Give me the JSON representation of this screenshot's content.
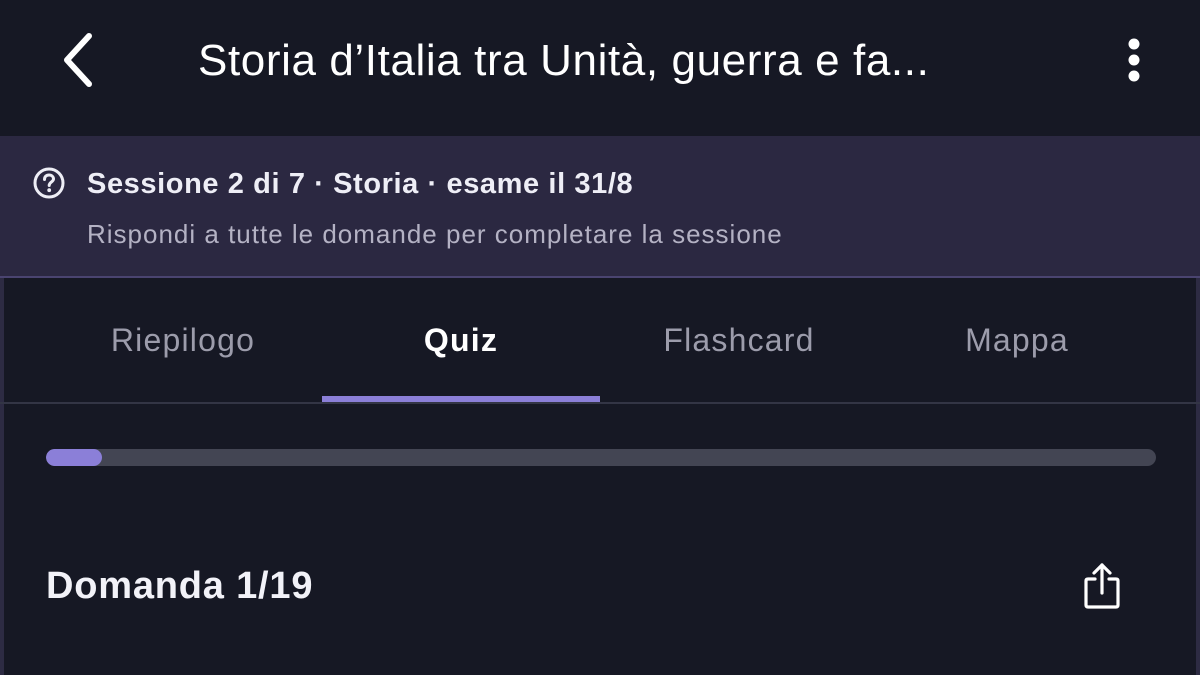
{
  "header": {
    "title": "Storia d’Italia tra Unità, guerra e fa...",
    "back_icon": "chevron-left-icon",
    "more_icon": "more-vertical-icon"
  },
  "session": {
    "icon": "help-circle-icon",
    "title": "Sessione 2 di 7 · Storia · esame il 31/8",
    "subtitle": "Rispondi a tutte le domande per completare la sessione"
  },
  "tabs": [
    {
      "label": "Riepilogo",
      "active": false
    },
    {
      "label": "Quiz",
      "active": true
    },
    {
      "label": "Flashcard",
      "active": false
    },
    {
      "label": "Mappa",
      "active": false
    }
  ],
  "progress": {
    "current": 1,
    "total": 19,
    "fraction": 0.05
  },
  "question": {
    "label": "Domanda 1/19",
    "share_icon": "share-icon"
  },
  "colors": {
    "background": "#161824",
    "banner": "#2b2841",
    "accent": "#8b7fd8",
    "track": "#434553"
  }
}
